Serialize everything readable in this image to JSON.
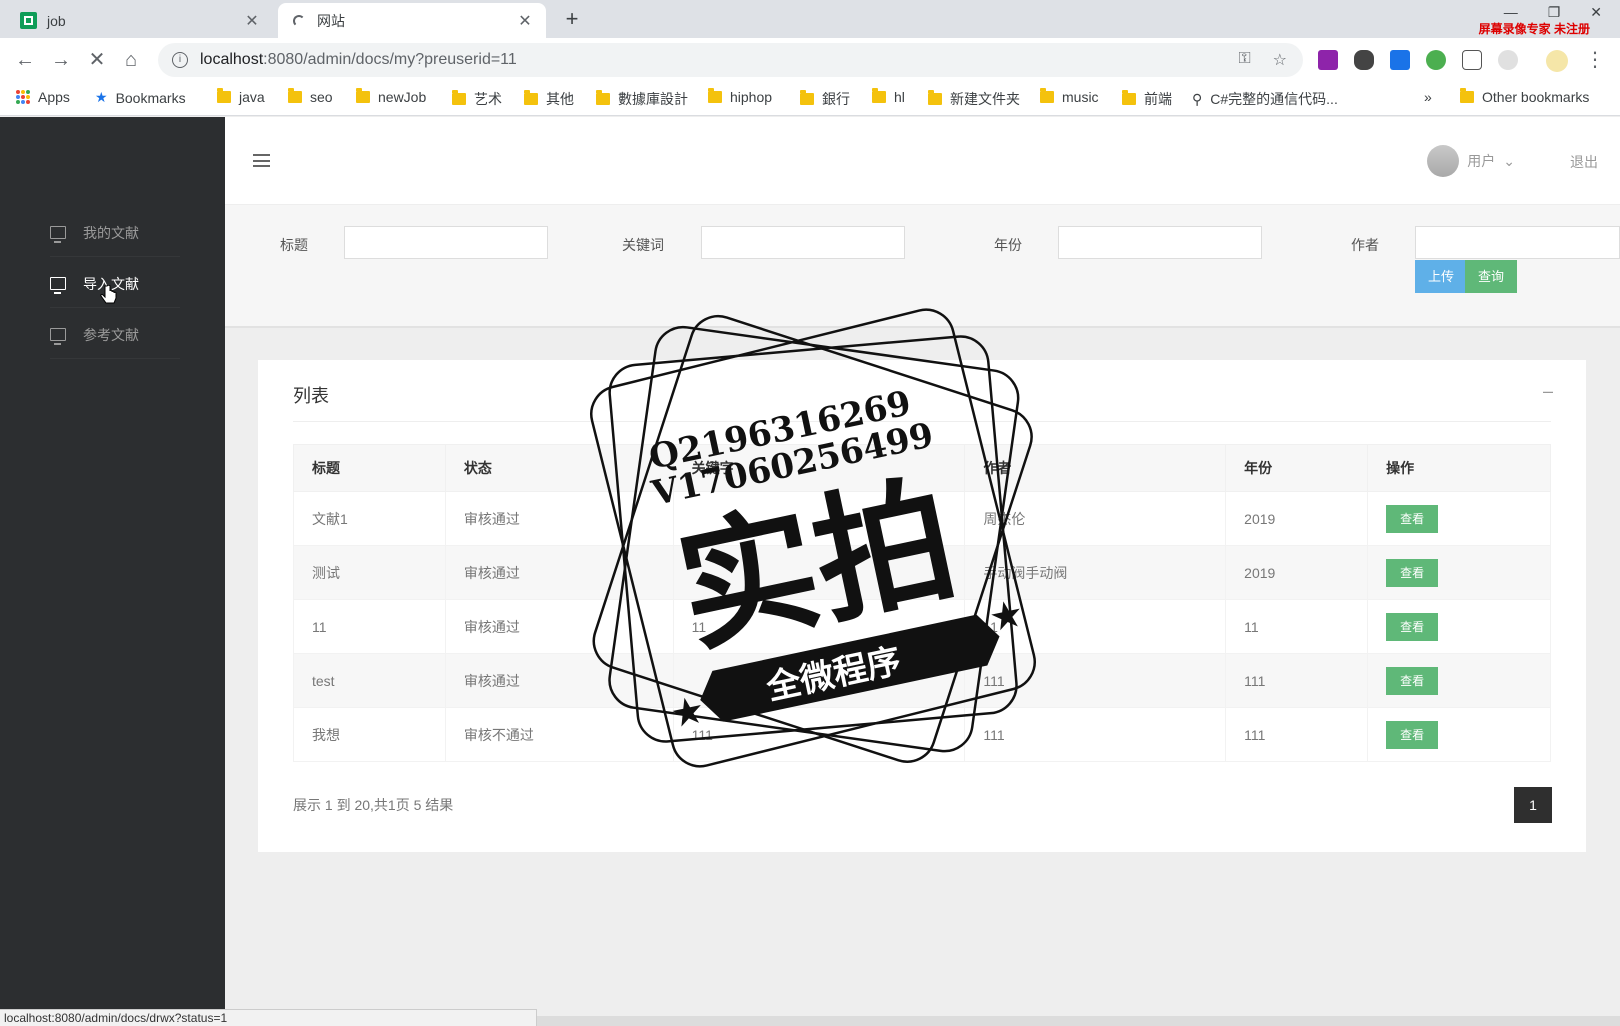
{
  "browser": {
    "tabs": [
      {
        "title": "job",
        "active": false
      },
      {
        "title": "网站",
        "active": true
      }
    ],
    "recorder_watermark": "屏幕录像专家  未注册",
    "url_host": "localhost",
    "url_path": ":8080/admin/docs/my?preuserid=11",
    "bookmarks": [
      "Apps",
      "Bookmarks",
      "java",
      "seo",
      "newJob",
      "艺术",
      "其他",
      "數據庫設計",
      "hiphop",
      "銀行",
      "hl",
      "新建文件夹",
      "music",
      "前端",
      "C#完整的通信代码...",
      "»",
      "Other bookmarks"
    ],
    "status_url": "localhost:8080/admin/docs/drwx?status=1"
  },
  "sidebar": {
    "items": [
      {
        "label": "我的文献",
        "active": false
      },
      {
        "label": "导入文献",
        "active": true
      },
      {
        "label": "参考文献",
        "active": false
      }
    ]
  },
  "header": {
    "user_label": "用户",
    "logout_label": "退出"
  },
  "filters": {
    "title_label": "标题",
    "keyword_label": "关键词",
    "year_label": "年份",
    "author_label": "作者",
    "upload_label": "上传",
    "query_label": "查询"
  },
  "list": {
    "title": "列表",
    "collapse": "–",
    "columns": [
      "标题",
      "状态",
      "关键字",
      "作者",
      "年份",
      "操作"
    ],
    "rows": [
      {
        "title": "文献1",
        "status": "审核通过",
        "keyword": "",
        "author": "周杰伦",
        "year": "2019",
        "action": "查看"
      },
      {
        "title": "测试",
        "status": "审核通过",
        "keyword": "",
        "author": "手动阀手动阀",
        "year": "2019",
        "action": "查看"
      },
      {
        "title": "11",
        "status": "审核通过",
        "keyword": "11",
        "author": "11",
        "year": "11",
        "action": "查看"
      },
      {
        "title": "test",
        "status": "审核通过",
        "keyword": "",
        "author": "111",
        "year": "111",
        "action": "查看"
      },
      {
        "title": "我想",
        "status": "审核不通过",
        "keyword": "111",
        "author": "111",
        "year": "111",
        "action": "查看"
      }
    ],
    "summary": "展示 1 到 20,共1页 5 结果",
    "current_page": "1"
  },
  "stamp": {
    "line1": "Q2196316269",
    "line2": "V17060256499",
    "big_text": "实拍",
    "ribbon_text": "全微程序"
  }
}
